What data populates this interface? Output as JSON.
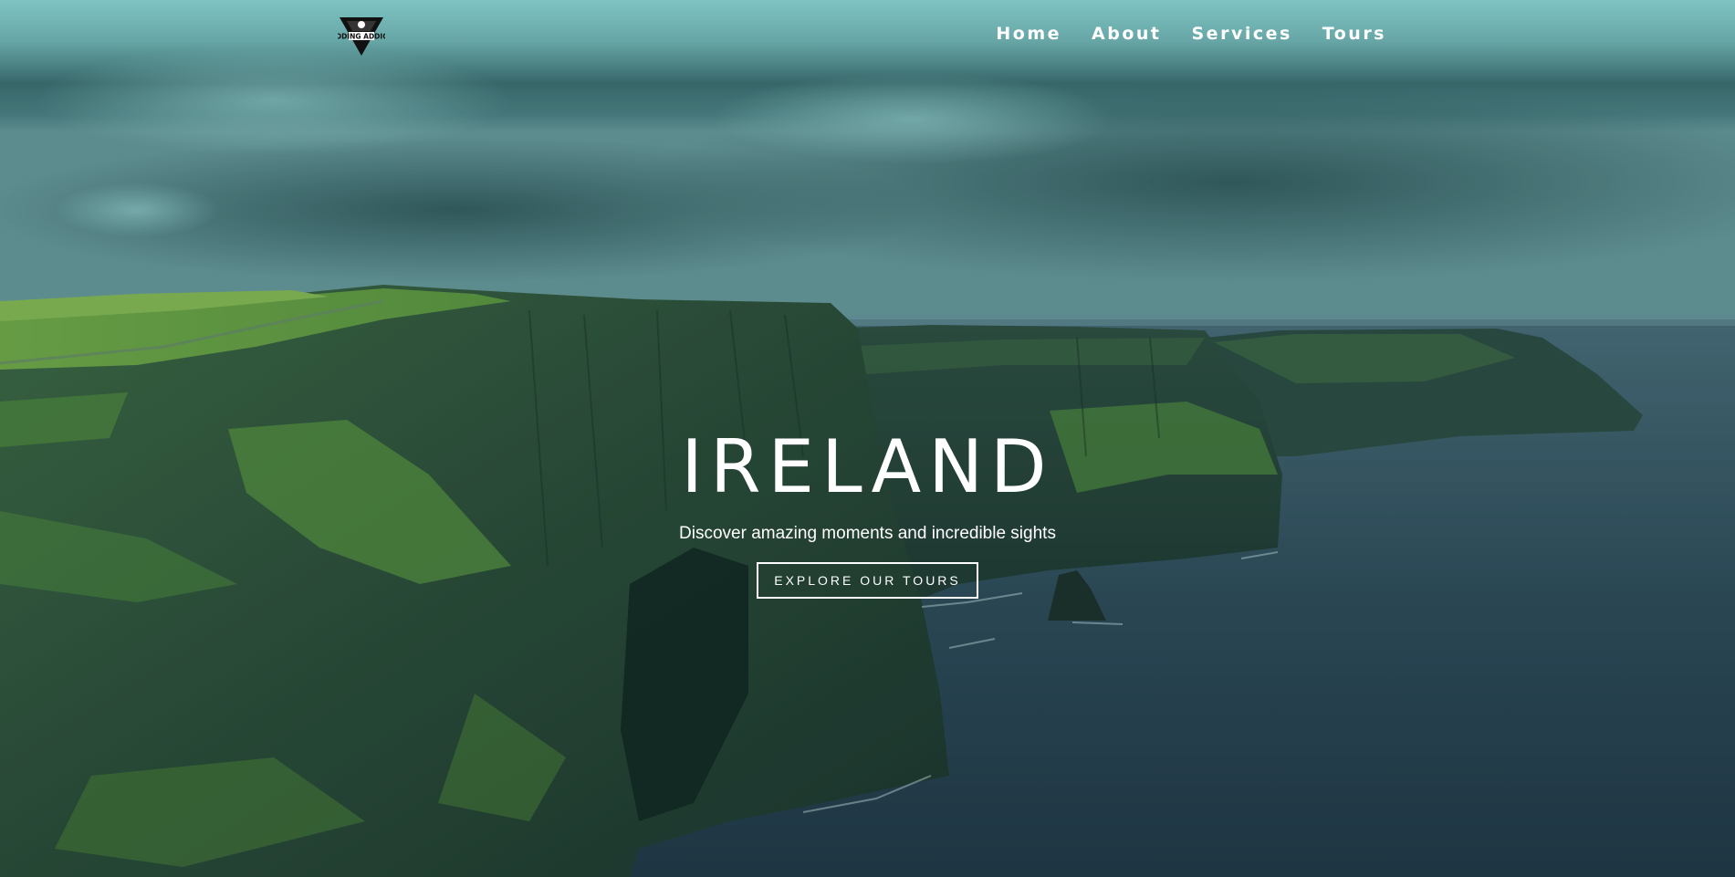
{
  "brand": {
    "logo_icon": "coding-addict-logo",
    "logo_text": "CODING ADDICT"
  },
  "nav": {
    "items": [
      {
        "label": "Home"
      },
      {
        "label": "About"
      },
      {
        "label": "Services"
      },
      {
        "label": "Tours"
      }
    ]
  },
  "hero": {
    "title": "IRELAND",
    "subtitle": "Discover amazing moments and incredible sights",
    "cta_label": "EXPLORE OUR TOURS"
  },
  "colors": {
    "overlay_teal": "#8fe3df",
    "text": "#ffffff"
  }
}
